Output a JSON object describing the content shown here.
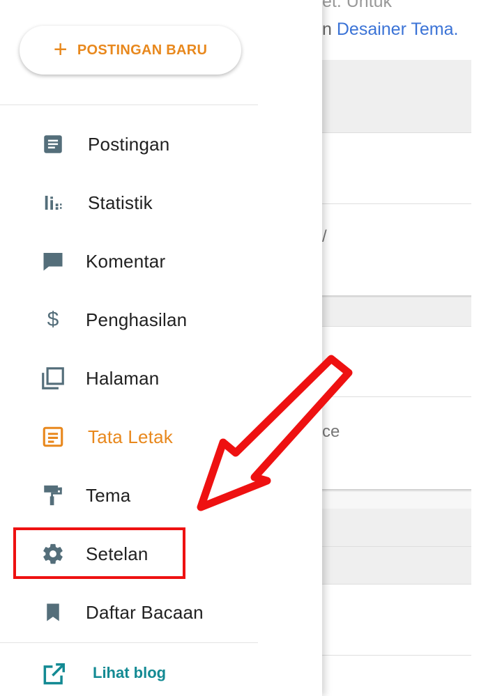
{
  "background": {
    "top_fragment": "et. Untuk",
    "line2_prefix": "n ",
    "line2_link": "Desainer Tema.",
    "fragment_1": "/",
    "fragment_2": "ce"
  },
  "drawer": {
    "new_post_label": "POSTINGAN BARU",
    "items": [
      {
        "label": "Postingan",
        "icon": "posts-icon"
      },
      {
        "label": "Statistik",
        "icon": "stats-icon"
      },
      {
        "label": "Komentar",
        "icon": "comment-icon"
      },
      {
        "label": "Penghasilan",
        "icon": "dollar-icon"
      },
      {
        "label": "Halaman",
        "icon": "pages-icon"
      },
      {
        "label": "Tata Letak",
        "icon": "layout-icon",
        "active": true
      },
      {
        "label": "Tema",
        "icon": "theme-roller-icon"
      },
      {
        "label": "Setelan",
        "icon": "gear-icon"
      },
      {
        "label": "Daftar Bacaan",
        "icon": "bookmark-icon"
      }
    ],
    "footer_link": "Lihat blog"
  },
  "colors": {
    "accent": "#e8881d",
    "icon": "#546e7a",
    "footer": "#138a93",
    "annotation": "#ee1111"
  }
}
